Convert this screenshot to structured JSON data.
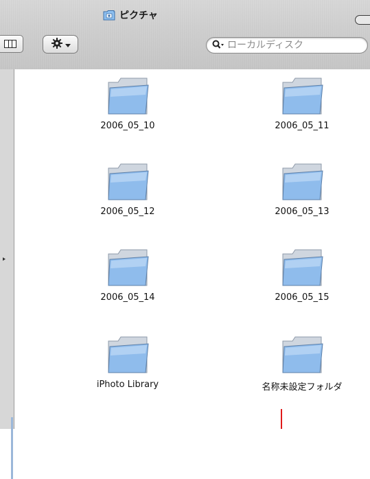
{
  "window": {
    "title": "ピクチャ",
    "title_icon": "pictures-folder-icon"
  },
  "toolbar": {
    "view_button_icon": "column-view-icon",
    "action_button_icon": "gear-icon",
    "action_menu_arrow": "chevron-down-icon",
    "search": {
      "icon": "search-icon",
      "placeholder": "ローカルディスク"
    }
  },
  "folders": [
    {
      "label": "2006_05_10"
    },
    {
      "label": "2006_05_11"
    },
    {
      "label": "2006_05_12"
    },
    {
      "label": "2006_05_13"
    },
    {
      "label": "2006_05_14"
    },
    {
      "label": "2006_05_15"
    },
    {
      "label": "iPhoto Library"
    },
    {
      "label": "名称未設定フォルダ"
    }
  ],
  "colors": {
    "folder_blue": "#7fb0e8",
    "cursor_red": "#e01a1a"
  }
}
